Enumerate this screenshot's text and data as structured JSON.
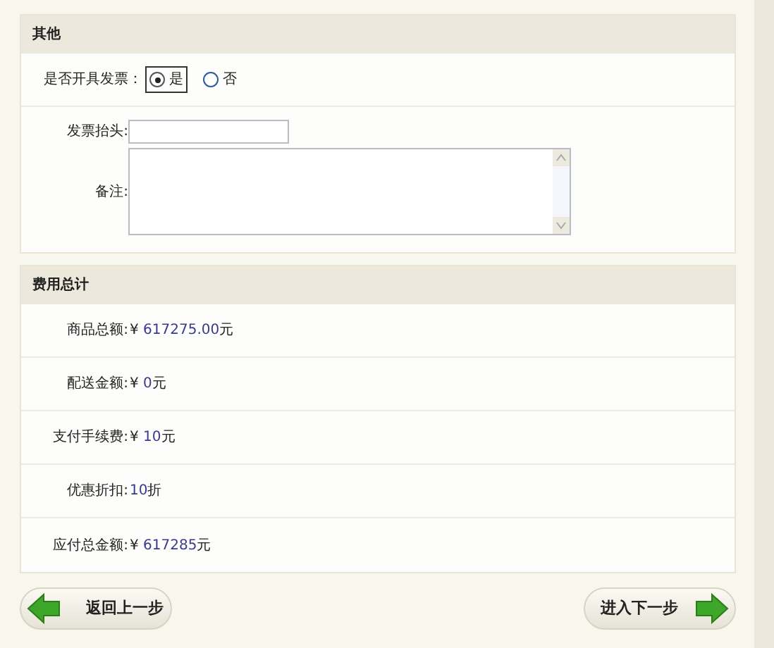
{
  "other_panel": {
    "title": "其他",
    "invoice_question": {
      "label": "是否开具发票：",
      "options": [
        {
          "label": "是",
          "selected": true
        },
        {
          "label": "否",
          "selected": false
        }
      ]
    },
    "fields": [
      {
        "kind": "input",
        "label": "发票抬头:"
      },
      {
        "kind": "textarea",
        "label": "备注:"
      }
    ]
  },
  "totals_panel": {
    "title": "费用总计",
    "rows": [
      {
        "label": "商品总额:",
        "currency": "¥",
        "amount": "617275.00",
        "unit": "元"
      },
      {
        "label": "配送金额:",
        "currency": "¥",
        "amount": "0",
        "unit": "元"
      },
      {
        "label": "支付手续费:",
        "currency": "¥",
        "amount": "10",
        "unit": "元"
      },
      {
        "label": "优惠折扣:",
        "amount": "10",
        "unit": "折"
      },
      {
        "label": "应付总金额:",
        "currency": "¥",
        "amount": "617285",
        "unit": "元"
      }
    ]
  },
  "buttons": [
    {
      "kind": "back",
      "label": "返回上一步"
    },
    {
      "kind": "next",
      "label": "进入下一步"
    }
  ]
}
